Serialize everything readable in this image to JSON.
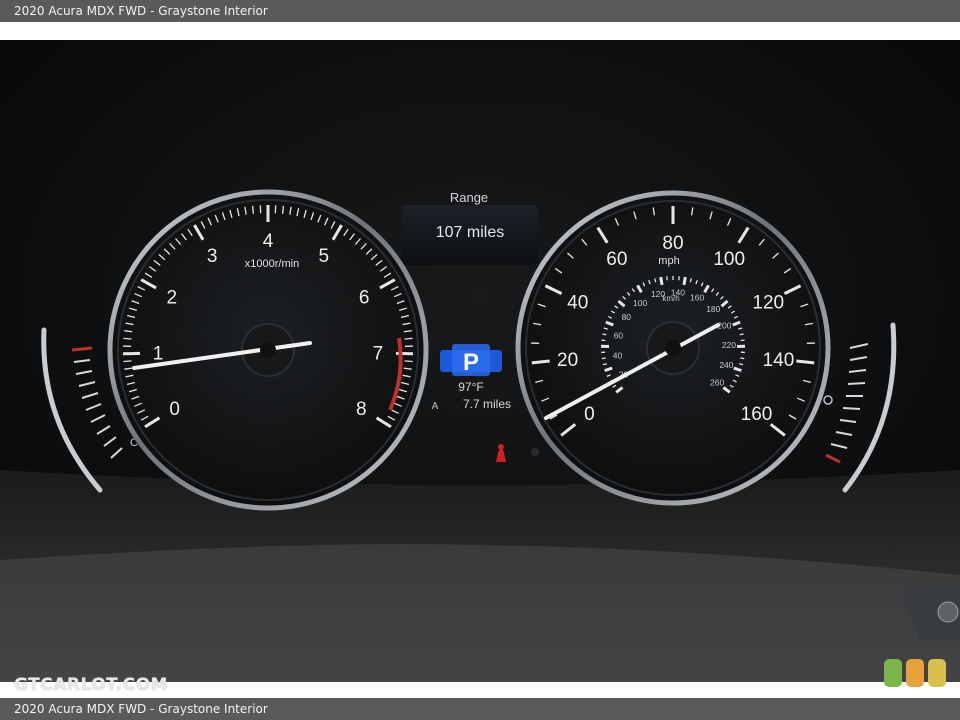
{
  "caption": "2020 Acura MDX FWD - Graystone Interior",
  "watermark": "GTCARLOT.COM",
  "tachometer": {
    "numbers": [
      "0",
      "1",
      "2",
      "3",
      "4",
      "5",
      "6",
      "7",
      "8"
    ],
    "unit_label": "x1000r/min",
    "needle_reading": "~0.9"
  },
  "speedometer": {
    "mph_numbers": [
      "0",
      "20",
      "40",
      "60",
      "80",
      "100",
      "120",
      "140",
      "160"
    ],
    "mph_unit": "mph",
    "kmh_numbers": [
      "20",
      "40",
      "60",
      "80",
      "100",
      "120",
      "140",
      "160",
      "180",
      "200",
      "220",
      "240",
      "260"
    ],
    "kmh_unit": "km/h"
  },
  "info_display": {
    "range_label": "Range",
    "range_value": "107 miles",
    "gear": "P",
    "temperature": "97°F",
    "trip_label": "A",
    "trip_value": "7.7 miles"
  },
  "temp_gauge_label": "C",
  "logo_colors": [
    "#7ab648",
    "#e6a33c",
    "#d9c04a"
  ]
}
